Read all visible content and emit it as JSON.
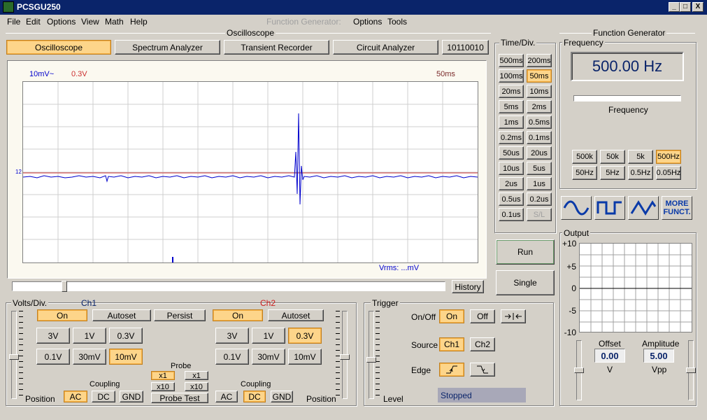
{
  "window": {
    "title": "PCSGU250",
    "min": "_",
    "max": "□",
    "close": "X"
  },
  "menu": {
    "file": "File",
    "edit": "Edit",
    "options": "Options",
    "view": "View",
    "math": "Math",
    "help": "Help",
    "fg_label": "Function Generator:",
    "fg_options": "Options",
    "fg_tools": "Tools"
  },
  "osc": {
    "group_label": "Oscilloscope",
    "tabs": {
      "oscilloscope": "Oscilloscope",
      "spectrum": "Spectrum Analyzer",
      "transient": "Transient Recorder",
      "circuit": "Circuit Analyzer",
      "code": "10110010"
    },
    "ch1_scale": "10mV~",
    "ch2_scale": "0.3V",
    "timebase": "50ms",
    "marker": "12",
    "vrms": "Vrms: ...mV",
    "history": "History"
  },
  "timediv": {
    "label": "Time/Div.",
    "buttons": [
      [
        "500ms",
        "200ms"
      ],
      [
        "100ms",
        "50ms"
      ],
      [
        "20ms",
        "10ms"
      ],
      [
        "5ms",
        "2ms"
      ],
      [
        "1ms",
        "0.5ms"
      ],
      [
        "0.2ms",
        "0.1ms"
      ],
      [
        "50us",
        "20us"
      ],
      [
        "10us",
        "5us"
      ],
      [
        "2us",
        "1us"
      ],
      [
        "0.5us",
        "0.2us"
      ],
      [
        "0.1us",
        "S/L"
      ]
    ],
    "selected": "50ms",
    "run": "Run",
    "single": "Single"
  },
  "volts": {
    "label": "Volts/Div.",
    "ch1": "Ch1",
    "ch2": "Ch2",
    "on": "On",
    "autoset": "Autoset",
    "persist": "Persist",
    "ch1_buttons": [
      [
        "3V",
        "1V",
        "0.3V"
      ],
      [
        "0.1V",
        "30mV",
        "10mV"
      ]
    ],
    "ch2_buttons": [
      [
        "3V",
        "1V",
        "0.3V"
      ],
      [
        "0.1V",
        "30mV",
        "10mV"
      ]
    ],
    "ch1_selected": "10mV",
    "ch2_selected": "0.3V",
    "probe": "Probe",
    "x1": "x1",
    "x10": "x10",
    "probe_test": "Probe Test",
    "coupling": "Coupling",
    "ac": "AC",
    "dc": "DC",
    "gnd": "GND",
    "position": "Position",
    "ch1_coupling": "AC",
    "ch2_coupling": "DC"
  },
  "trigger": {
    "label": "Trigger",
    "onoff": "On/Off",
    "on": "On",
    "off": "Off",
    "source": "Source",
    "ch1": "Ch1",
    "ch2": "Ch2",
    "edge": "Edge",
    "level": "Level",
    "status": "Stopped"
  },
  "fg": {
    "group_label": "Function Generator",
    "frequency_label": "Frequency",
    "frequency_value": "500.00 Hz",
    "slider_label": "Frequency",
    "range_row1": [
      "500k",
      "50k",
      "5k",
      "500Hz"
    ],
    "range_row2": [
      "50Hz",
      "5Hz",
      "0.5Hz",
      "0.05Hz"
    ],
    "range_selected": "500Hz",
    "more": "MORE FUNCT.",
    "output_label": "Output",
    "y_ticks": [
      "+10",
      "+5",
      "0",
      "-5",
      "-10"
    ],
    "offset_label": "Offset",
    "offset_value": "0.00",
    "offset_unit": "V",
    "amplitude_label": "Amplitude",
    "amplitude_value": "5.00",
    "amplitude_unit": "Vpp"
  },
  "colors": {
    "ch1_trace": "#0000cc",
    "ch2_trace": "#cc3030",
    "selected_btn": "#fdd58a",
    "title_bar": "#0a246a"
  }
}
